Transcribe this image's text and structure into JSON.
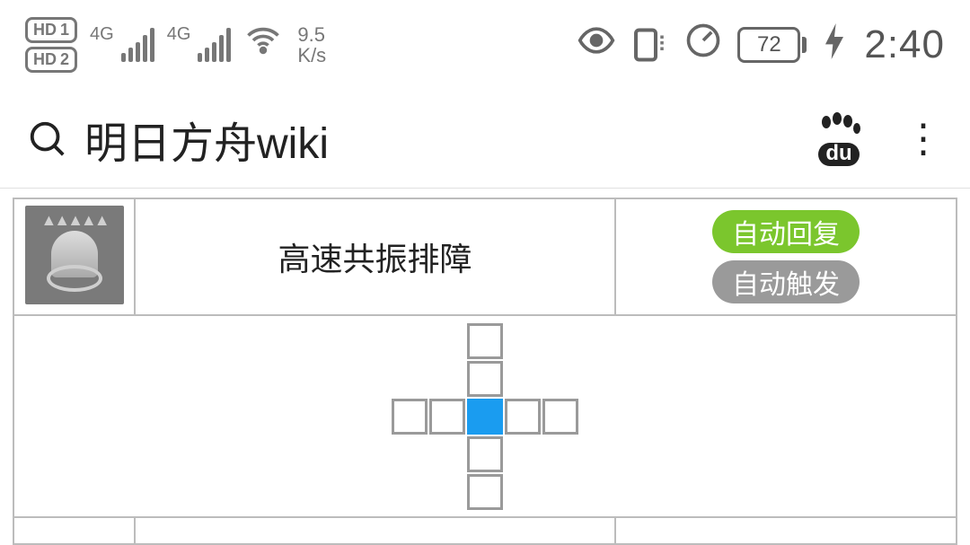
{
  "status": {
    "hd1": "HD 1",
    "hd2": "HD 2",
    "net_label": "4G",
    "speed_top": "9.5",
    "speed_bot": "K/s",
    "battery": "72",
    "time": "2:40"
  },
  "chrome": {
    "search_query": "明日方舟wiki",
    "baidu_label": "du"
  },
  "skill": {
    "name": "高速共振排障",
    "tags": {
      "recovery": "自动回复",
      "trigger": "自动触发"
    },
    "range": {
      "grid": [
        [
          0,
          0,
          1,
          0,
          0
        ],
        [
          0,
          0,
          1,
          0,
          0
        ],
        [
          1,
          1,
          2,
          1,
          1
        ],
        [
          0,
          0,
          1,
          0,
          0
        ],
        [
          0,
          0,
          1,
          0,
          0
        ]
      ]
    }
  }
}
